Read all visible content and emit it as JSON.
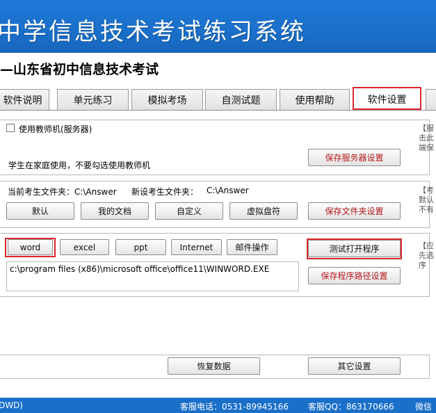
{
  "header": {
    "title": "中学信息技术考试练习系统",
    "subtitle": "—山东省初中信息技术考试"
  },
  "tabs": [
    "软件说明",
    "单元练习",
    "模拟考场",
    "自测试题",
    "使用帮助",
    "软件设置"
  ],
  "server": {
    "checkbox_label": "使用教师机(服务器)",
    "checked": false,
    "hint": "学生在家庭使用，不要勾选使用教师机",
    "save_label": "保存服务器设置"
  },
  "folder": {
    "current_label": "当前考生文件夹：C:\\Answer",
    "new_label": "新设考生文件夹：",
    "new_value": "C:\\Answer",
    "buttons": [
      "默认",
      "我的文档",
      "自定义",
      "虚拟盘符"
    ],
    "save_label": "保存文件夹设置"
  },
  "programs": {
    "buttons": [
      "word",
      "excel",
      "ppt",
      "Internet",
      "邮件操作"
    ],
    "path": "c:\\program files (x86)\\microsoft office\\office11\\WINWORD.EXE",
    "test_label": "测试打开程序",
    "save_label": "保存程序路径设置"
  },
  "bottom": {
    "restore_label": "恢复数据",
    "other_label": "其它设置"
  },
  "side_notes": {
    "n1": [
      "【服",
      "击此",
      "端保"
    ],
    "n2": [
      "【考",
      "默认",
      "不有"
    ],
    "n3": [
      "【应",
      "先选",
      "序"
    ]
  },
  "status": {
    "left": "DWD)",
    "phone": "客服电话：0531-89945166",
    "qq": "客服QQ：863170666",
    "right": "微信"
  },
  "colors": {
    "title_bg": "#1a6fc9",
    "highlight": "#d9262b",
    "accent_text": "#b3171b"
  }
}
